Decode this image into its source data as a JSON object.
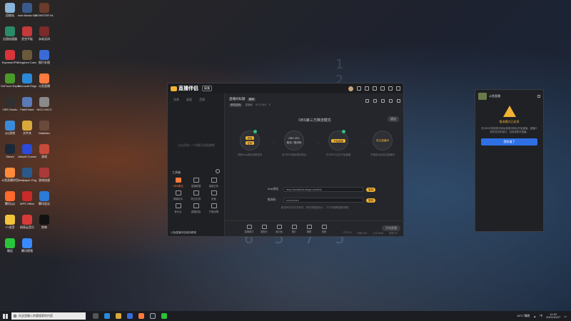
{
  "desktop_icons": [
    {
      "label": "回收站",
      "color": "#8ab4d8"
    },
    {
      "label": "Intel Media\nNCenter",
      "color": "#3a5a8a"
    },
    {
      "label": "MONSTER\nHUNTER",
      "color": "#6a3a2a"
    },
    {
      "label": "迅游加速器",
      "color": "#2a8a6a"
    },
    {
      "label": "亚克平板",
      "color": "#c43a3a"
    },
    {
      "label": "永劫无间",
      "color": "#7a2a2a"
    },
    {
      "label": "ExpressVPN",
      "color": "#d8343a"
    },
    {
      "label": "Kingdom Come",
      "color": "#6a5a3a"
    },
    {
      "label": "图片处理",
      "color": "#3a6ad8"
    },
    {
      "label": "GeForce Experience",
      "color": "#4a9a2a"
    },
    {
      "label": "Microsoft Edge",
      "color": "#2a8ad8"
    },
    {
      "label": "斗鱼直播",
      "color": "#ff7a3c"
    },
    {
      "label": "OBS Studio",
      "color": "#303030"
    },
    {
      "label": "PathFinder",
      "color": "#5a7ab8"
    },
    {
      "label": "NICO NICO",
      "color": "#8a8a8a"
    },
    {
      "label": "QQ游戏",
      "color": "#3a8ad8"
    },
    {
      "label": "文件夹",
      "color": "#d8a83a"
    },
    {
      "label": "Gladiator",
      "color": "#6a4a3a"
    },
    {
      "label": "Steam",
      "color": "#1b2838"
    },
    {
      "label": "Ubisoft Connect",
      "color": "#2a4ad8"
    },
    {
      "label": "游戏",
      "color": "#c84a3a"
    },
    {
      "label": "斗鱼直播伴侣",
      "color": "#ff8a3a"
    },
    {
      "label": "Wallpaper Engine",
      "color": "#2a5a8a"
    },
    {
      "label": "游戏加速",
      "color": "#aa3a3a"
    },
    {
      "label": "腾讯QQ",
      "color": "#ff6a2a"
    },
    {
      "label": "WPS Office",
      "color": "#c82a2a"
    },
    {
      "label": "腾讯会议",
      "color": "#2a7ad8"
    },
    {
      "label": "YY语音",
      "color": "#f2c43a"
    },
    {
      "label": "网易云音乐",
      "color": "#d83a3a"
    },
    {
      "label": "剪映",
      "color": "#111111"
    },
    {
      "label": "微信",
      "color": "#2ac43a"
    },
    {
      "label": "腾讯视频",
      "color": "#3a8aff"
    }
  ],
  "app": {
    "name": "直播伴侣",
    "version": "标准",
    "left_tabs": [
      "场景",
      "画面",
      "音频"
    ],
    "left_empty": "点击添加一个场景开始直播吧",
    "tools_title": "工具箱",
    "tools": [
      {
        "label": "OBS推流"
      },
      {
        "label": "直播数据"
      },
      {
        "label": "直播日历"
      },
      {
        "label": "弹幕助手"
      },
      {
        "label": "粉丝礼物"
      },
      {
        "label": "房管"
      },
      {
        "label": "音乐台"
      },
      {
        "label": "直播回放"
      },
      {
        "label": "开播设置"
      }
    ],
    "left_footer": "斗鱼直播伴侣使用教程",
    "header": {
      "room_title": "直播间标题",
      "tag": "编辑",
      "category": "单机游戏",
      "sub_items": [
        "直播间",
        "ID:71318",
        "0"
      ]
    },
    "mode_title": "OBS第三方推流模式",
    "exit_label": "退出",
    "steps": [
      {
        "pills": [
          "获取",
          "复制"
        ],
        "caption": "获取rtmp地址和推流码",
        "done": true
      },
      {
        "texts": [
          "OBS URL",
          "推流 / 推流码"
        ],
        "caption": "在OBS中粘贴推流地址",
        "done": false
      },
      {
        "pills": [
          "开始直播"
        ],
        "caption": "在OBS中点击开始直播",
        "done": true
      },
      {
        "texts": [
          "前往直播间"
        ],
        "caption": "开播成功后前往直播间",
        "done": false
      }
    ],
    "rtmp_label": "rtmp地址",
    "rtmp_value": "rtmp://sendtc3a.douyu.com/live",
    "code_label": "推流码",
    "code_value": "••••••••••••••",
    "copy_label": "复制",
    "note": "推流码仅在本次有效，请勿泄露给他人，下次开播需重新获取",
    "bottom_tools": [
      {
        "label": "直播模式"
      },
      {
        "label": "摄像头"
      },
      {
        "label": "画中画"
      },
      {
        "label": "图片"
      },
      {
        "label": "截图"
      },
      {
        "label": "音频"
      }
    ],
    "start_label": "开始直播",
    "status": [
      "CPU 2%",
      "内存 15%",
      "上行 0kb/s",
      "丢帧 0%"
    ]
  },
  "popup": {
    "name": "斗鱼直播",
    "title": "推流模式已启用",
    "text": "在OBS中粘贴推流地址和推流码后开始直播，直播中请勿关闭本窗口，否则将断开直播。",
    "button": "我知道了"
  },
  "taskbar": {
    "search_placeholder": "在这里输入你要搜索的内容",
    "weather": "18°C 晴朗",
    "lang": "中",
    "time": "11:02",
    "date": "2021/10/27"
  }
}
